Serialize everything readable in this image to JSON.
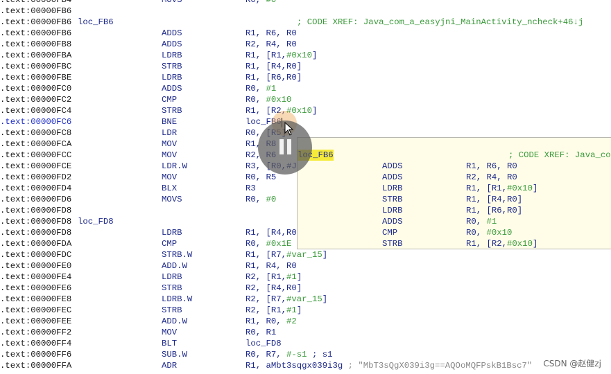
{
  "listing": [
    {
      "addr": ".text:00000FB4",
      "label": "",
      "mn": "MOVS",
      "op": [
        [
          "R0, ",
          ""
        ],
        [
          "#0",
          "num"
        ]
      ],
      "cm": ""
    },
    {
      "addr": ".text:00000FB6",
      "label": "",
      "mn": "",
      "op": [],
      "cm": ""
    },
    {
      "addr": ".text:00000FB6",
      "label": "loc_FB6",
      "mn": "",
      "op": [],
      "cm": "; CODE XREF: Java_com_a_easyjni_MainActivity_ncheck+46↓j"
    },
    {
      "addr": ".text:00000FB6",
      "label": "",
      "mn": "ADDS",
      "op": [
        [
          "R1, R6, R0",
          ""
        ]
      ],
      "cm": ""
    },
    {
      "addr": ".text:00000FB8",
      "label": "",
      "mn": "ADDS",
      "op": [
        [
          "R2, R4, R0",
          ""
        ]
      ],
      "cm": ""
    },
    {
      "addr": ".text:00000FBA",
      "label": "",
      "mn": "LDRB",
      "op": [
        [
          "R1, [R1,",
          ""
        ],
        [
          "#0x10",
          "num"
        ],
        [
          "]",
          ""
        ]
      ],
      "cm": ""
    },
    {
      "addr": ".text:00000FBC",
      "label": "",
      "mn": "STRB",
      "op": [
        [
          "R1, [R4,R0]",
          ""
        ]
      ],
      "cm": ""
    },
    {
      "addr": ".text:00000FBE",
      "label": "",
      "mn": "LDRB",
      "op": [
        [
          "R1, [R6,R0]",
          ""
        ]
      ],
      "cm": ""
    },
    {
      "addr": ".text:00000FC0",
      "label": "",
      "mn": "ADDS",
      "op": [
        [
          "R0, ",
          ""
        ],
        [
          "#1",
          "num"
        ]
      ],
      "cm": ""
    },
    {
      "addr": ".text:00000FC2",
      "label": "",
      "mn": "CMP",
      "op": [
        [
          "R0, ",
          ""
        ],
        [
          "#0x10",
          "num"
        ]
      ],
      "cm": ""
    },
    {
      "addr": ".text:00000FC4",
      "label": "",
      "mn": "STRB",
      "op": [
        [
          "R1, [R2,",
          ""
        ],
        [
          "#0x10",
          "num"
        ],
        [
          "]",
          ""
        ]
      ],
      "cm": ""
    },
    {
      "addr": ".text:00000FC6",
      "label": "",
      "mn": "BNE",
      "op": [
        [
          "loc_FB6",
          ""
        ]
      ],
      "cm": "",
      "current": true
    },
    {
      "addr": ".text:00000FC8",
      "label": "",
      "mn": "LDR",
      "op": [
        [
          "R0, [R5]",
          ""
        ]
      ],
      "cm": ""
    },
    {
      "addr": ".text:00000FCA",
      "label": "",
      "mn": "MOV",
      "op": [
        [
          "R1, R8",
          ""
        ]
      ],
      "cm": ""
    },
    {
      "addr": ".text:00000FCC",
      "label": "",
      "mn": "MOV",
      "op": [
        [
          "R2, R6",
          ""
        ]
      ],
      "cm": ""
    },
    {
      "addr": ".text:00000FCE",
      "label": "",
      "mn": "LDR.W",
      "op": [
        [
          "R3, [R0,#J",
          ""
        ]
      ],
      "cm": ""
    },
    {
      "addr": ".text:00000FD2",
      "label": "",
      "mn": "MOV",
      "op": [
        [
          "R0, R5",
          ""
        ]
      ],
      "cm": ""
    },
    {
      "addr": ".text:00000FD4",
      "label": "",
      "mn": "BLX",
      "op": [
        [
          "R3",
          ""
        ]
      ],
      "cm": ""
    },
    {
      "addr": ".text:00000FD6",
      "label": "",
      "mn": "MOVS",
      "op": [
        [
          "R0, ",
          ""
        ],
        [
          "#0",
          "num"
        ]
      ],
      "cm": ""
    },
    {
      "addr": ".text:00000FD8",
      "label": "",
      "mn": "",
      "op": [],
      "cm": ""
    },
    {
      "addr": ".text:00000FD8",
      "label": "loc_FD8",
      "mn": "",
      "op": [],
      "cm": ";"
    },
    {
      "addr": ".text:00000FD8",
      "label": "",
      "mn": "LDRB",
      "op": [
        [
          "R1, [R4,R0",
          ""
        ]
      ],
      "cm": ""
    },
    {
      "addr": ".text:00000FDA",
      "label": "",
      "mn": "CMP",
      "op": [
        [
          "R0, ",
          ""
        ],
        [
          "#0x1E",
          "num"
        ]
      ],
      "cm": ""
    },
    {
      "addr": ".text:00000FDC",
      "label": "",
      "mn": "STRB.W",
      "op": [
        [
          "R1, [R7,",
          ""
        ],
        [
          "#var_15",
          "num"
        ],
        [
          "]",
          ""
        ]
      ],
      "cm": ""
    },
    {
      "addr": ".text:00000FE0",
      "label": "",
      "mn": "ADD.W",
      "op": [
        [
          "R1, R4, R0",
          ""
        ]
      ],
      "cm": ""
    },
    {
      "addr": ".text:00000FE4",
      "label": "",
      "mn": "LDRB",
      "op": [
        [
          "R2, [R1,",
          ""
        ],
        [
          "#1",
          "num"
        ],
        [
          "]",
          ""
        ]
      ],
      "cm": ""
    },
    {
      "addr": ".text:00000FE6",
      "label": "",
      "mn": "STRB",
      "op": [
        [
          "R2, [R4,R0]",
          ""
        ]
      ],
      "cm": ""
    },
    {
      "addr": ".text:00000FE8",
      "label": "",
      "mn": "LDRB.W",
      "op": [
        [
          "R2, [R7,",
          ""
        ],
        [
          "#var_15",
          "num"
        ],
        [
          "]",
          ""
        ]
      ],
      "cm": ""
    },
    {
      "addr": ".text:00000FEC",
      "label": "",
      "mn": "STRB",
      "op": [
        [
          "R2, [R1,",
          ""
        ],
        [
          "#1",
          "num"
        ],
        [
          "]",
          ""
        ]
      ],
      "cm": ""
    },
    {
      "addr": ".text:00000FEE",
      "label": "",
      "mn": "ADD.W",
      "op": [
        [
          "R1, R0, ",
          ""
        ],
        [
          "#2",
          "num"
        ]
      ],
      "cm": ""
    },
    {
      "addr": ".text:00000FF2",
      "label": "",
      "mn": "MOV",
      "op": [
        [
          "R0, R1",
          ""
        ]
      ],
      "cm": ""
    },
    {
      "addr": ".text:00000FF4",
      "label": "",
      "mn": "BLT",
      "op": [
        [
          "loc_FD8",
          ""
        ]
      ],
      "cm": ""
    },
    {
      "addr": ".text:00000FF6",
      "label": "",
      "mn": "SUB.W",
      "op": [
        [
          "R0, R7, ",
          ""
        ],
        [
          "#-s1",
          "num"
        ],
        [
          " ; s1",
          ""
        ]
      ],
      "cm": ""
    },
    {
      "addr": ".text:00000FFA",
      "label": "",
      "mn": "ADR",
      "op": [
        [
          "R1, aMbt3sqgx039i3g ",
          ""
        ],
        [
          "; \"MbT3sQgX039i3g==AQOoMQFPskB1Bsc7\"",
          "str"
        ]
      ],
      "cm": ""
    }
  ],
  "tooltip": [
    {
      "label": "loc_FB6",
      "mn": "",
      "op": [],
      "cm": "; CODE XREF: Java_co"
    },
    {
      "label": "",
      "mn": "ADDS",
      "op": [
        [
          "R1, R6, R0",
          ""
        ]
      ],
      "cm": ""
    },
    {
      "label": "",
      "mn": "ADDS",
      "op": [
        [
          "R2, R4, R0",
          ""
        ]
      ],
      "cm": ""
    },
    {
      "label": "",
      "mn": "LDRB",
      "op": [
        [
          "R1, [R1,",
          ""
        ],
        [
          "#0x10",
          "num"
        ],
        [
          "]",
          ""
        ]
      ],
      "cm": ""
    },
    {
      "label": "",
      "mn": "STRB",
      "op": [
        [
          "R1, [R4,R0]",
          ""
        ]
      ],
      "cm": ""
    },
    {
      "label": "",
      "mn": "LDRB",
      "op": [
        [
          "R1, [R6,R0]",
          ""
        ]
      ],
      "cm": ""
    },
    {
      "label": "",
      "mn": "ADDS",
      "op": [
        [
          "R0, ",
          ""
        ],
        [
          "#1",
          "num"
        ]
      ],
      "cm": ""
    },
    {
      "label": "",
      "mn": "CMP",
      "op": [
        [
          "R0, ",
          ""
        ],
        [
          "#0x10",
          "num"
        ]
      ],
      "cm": ""
    },
    {
      "label": "",
      "mn": "STRB",
      "op": [
        [
          "R1, [R2,",
          ""
        ],
        [
          "#0x10",
          "num"
        ],
        [
          "]",
          ""
        ]
      ],
      "cm": ""
    }
  ],
  "watermark": "CSDN @赵健zj",
  "icons": {
    "overlay": "pause-icon",
    "pointer": "mouse-cursor-icon"
  },
  "colors": {
    "mnemonic": "#1e2a8a",
    "immediate": "#3a9a3a",
    "current_address": "#1e2ec8",
    "tooltip_bg": "#fffde8",
    "label_highlight": "#f5ea3a"
  }
}
